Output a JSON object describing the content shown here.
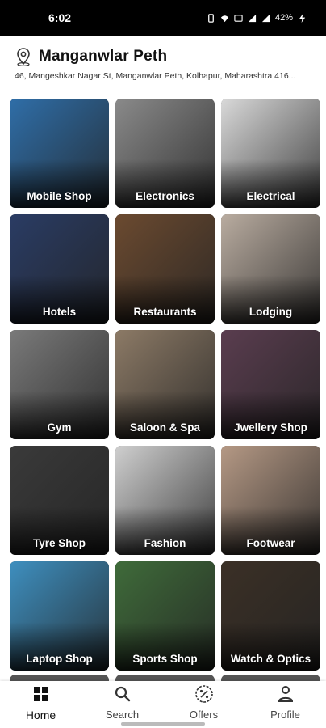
{
  "status_bar": {
    "time": "6:02",
    "battery": "42%"
  },
  "location": {
    "title": "Manganwlar Peth",
    "address": "46, Mangeshkar Nagar St, Manganwlar Peth, Kolhapur, Maharashtra 416..."
  },
  "categories": [
    {
      "label": "Mobile Shop",
      "icon": "smartphone-photo",
      "color": "#2f6ea8"
    },
    {
      "label": "Electronics",
      "icon": "appliances-photo",
      "color": "#8a8a8a"
    },
    {
      "label": "Electrical",
      "icon": "kitchen-appliances-photo",
      "color": "#d9d9d9"
    },
    {
      "label": "Hotels",
      "icon": "hotel-photo",
      "color": "#2a3c64"
    },
    {
      "label": "Restaurants",
      "icon": "restaurant-photo",
      "color": "#6b4a30"
    },
    {
      "label": "Lodging",
      "icon": "room-photo",
      "color": "#b9aca0"
    },
    {
      "label": "Gym",
      "icon": "gym-photo",
      "color": "#7a7a7a"
    },
    {
      "label": "Saloon & Spa",
      "icon": "salon-photo",
      "color": "#8c7a66"
    },
    {
      "label": "Jwellery Shop",
      "icon": "jewellery-photo",
      "color": "#5a3d4f"
    },
    {
      "label": "Tyre Shop",
      "icon": "tyres-photo",
      "color": "#3a3a3a"
    },
    {
      "label": "Fashion",
      "icon": "fashion-photo",
      "color": "#cfcfcf"
    },
    {
      "label": "Footwear",
      "icon": "shoes-photo",
      "color": "#b59985"
    },
    {
      "label": "Laptop Shop",
      "icon": "laptops-photo",
      "color": "#3e8fbf"
    },
    {
      "label": "Sports Shop",
      "icon": "sports-gear-photo",
      "color": "#3f6b3a"
    },
    {
      "label": "Watch & Optics",
      "icon": "watch-photo",
      "color": "#3b3026"
    }
  ],
  "bottom_nav": [
    {
      "label": "Home",
      "icon": "home-grid-icon",
      "active": true
    },
    {
      "label": "Search",
      "icon": "search-icon",
      "active": false
    },
    {
      "label": "Offers",
      "icon": "offers-percent-icon",
      "active": false
    },
    {
      "label": "Profile",
      "icon": "profile-icon",
      "active": false
    }
  ]
}
